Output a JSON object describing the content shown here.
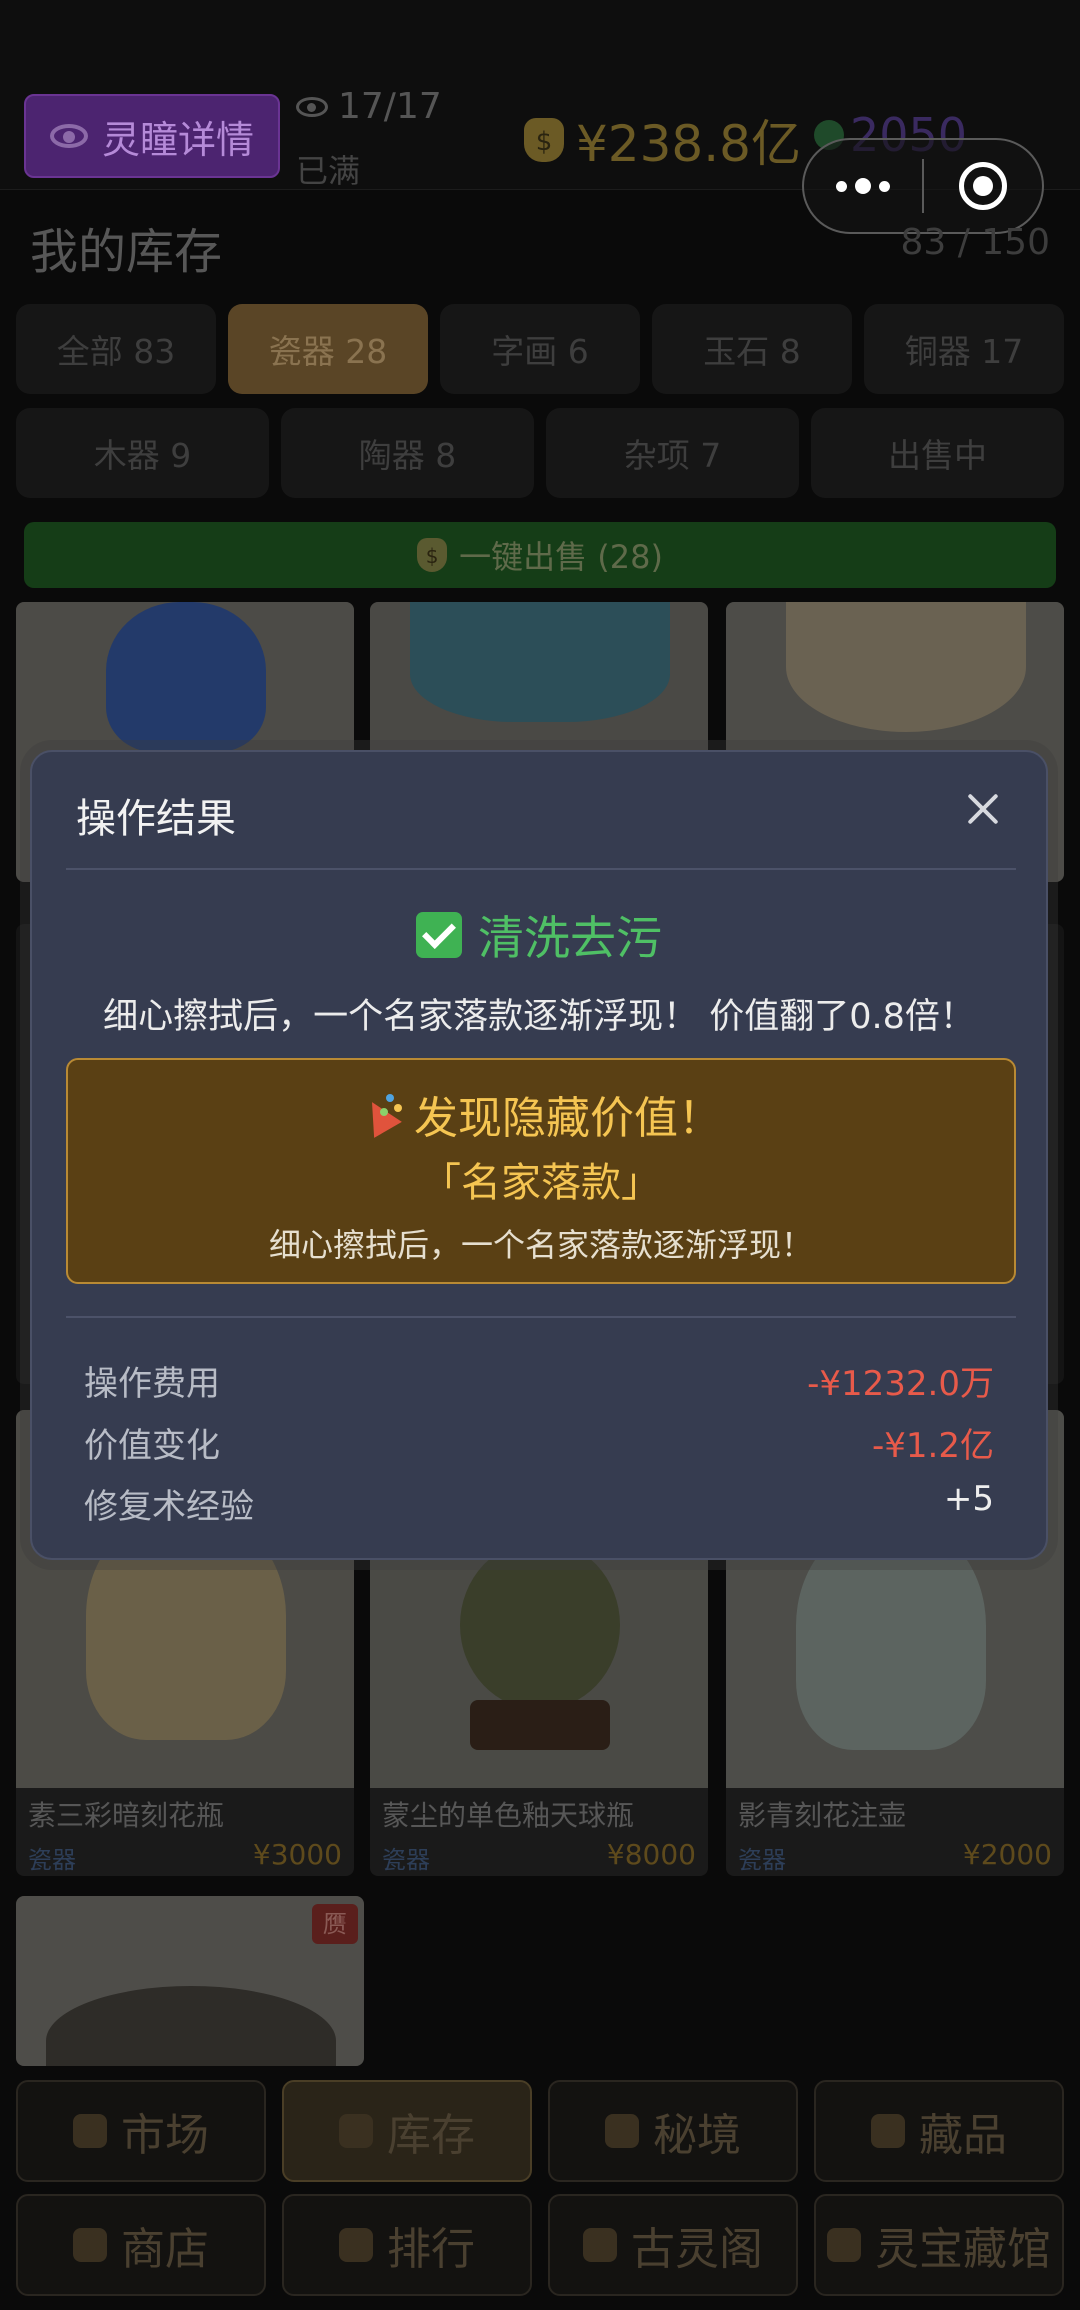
{
  "header": {
    "eye_button_label": "灵瞳详情",
    "eye_count": "17/17",
    "full_label": "已满",
    "money": "¥238.8亿",
    "gem": "2050"
  },
  "inventory": {
    "title": "我的库存",
    "count": "83 / 150"
  },
  "categories_row1": [
    "全部 83",
    "瓷器 28",
    "字画 6",
    "玉石 8",
    "铜器 17"
  ],
  "categories_row2": [
    "木器 9",
    "陶器 8",
    "杂项 7",
    "出售中"
  ],
  "active_category": "瓷器 28",
  "sell_all_label": "一键出售 (28)",
  "items": [
    {
      "name": "素三彩暗刻花瓶",
      "type": "瓷器",
      "price": "¥3000"
    },
    {
      "name": "蒙尘的单色釉天球瓶",
      "type": "瓷器",
      "price": "¥8000"
    },
    {
      "name": "影青刻花注壶",
      "type": "瓷器",
      "price": "¥2000"
    }
  ],
  "badge_label": "赝",
  "nav_row1": [
    "市场",
    "库存",
    "秘境",
    "藏品"
  ],
  "nav_row2": [
    "商店",
    "排行",
    "古灵阁",
    "灵宝藏馆"
  ],
  "modal": {
    "title": "操作结果",
    "result": "清洗去污",
    "description": "细心擦拭后，一个名家落款逐渐浮现！ 价值翻了0.8倍！",
    "hidden": {
      "title": "发现隐藏价值！",
      "name": "「名家落款」",
      "desc": "细心擦拭后，一个名家落款逐渐浮现！"
    },
    "stats": [
      {
        "label": "操作费用",
        "value": "-¥1232.0万"
      },
      {
        "label": "价值变化",
        "value": "-¥1.2亿"
      },
      {
        "label": "修复术经验",
        "value": "+5"
      }
    ]
  },
  "colors": {
    "accent_gold": "#f5c552",
    "success_green": "#4fc065",
    "negative_red": "#e85a4a",
    "modal_bg": "#363c50"
  }
}
